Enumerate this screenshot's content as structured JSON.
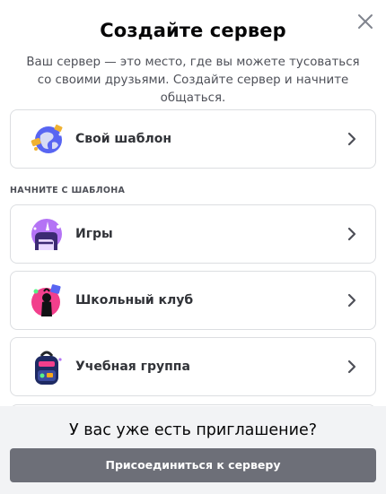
{
  "modal": {
    "title": "Создайте сервер",
    "subtitle": "Ваш сервер — это место, где вы можете тусоваться со своими друзьями. Создайте сервер и начните общаться.",
    "close_icon": "close-icon"
  },
  "options": {
    "custom": {
      "label": "Свой шаблон",
      "icon": "globe-icon"
    },
    "section_label": "НАЧНИТЕ С ШАБЛОНА",
    "templates": [
      {
        "label": "Игры",
        "icon": "gaming-icon"
      },
      {
        "label": "Школьный клуб",
        "icon": "school-club-icon"
      },
      {
        "label": "Учебная группа",
        "icon": "backpack-icon"
      }
    ]
  },
  "footer": {
    "title": "У вас уже есть приглашение?",
    "join_label": "Присоединиться к серверу"
  },
  "colors": {
    "footer_bg": "#f2f3f5",
    "button_bg": "#6d6f78",
    "border": "#dcdee1"
  }
}
